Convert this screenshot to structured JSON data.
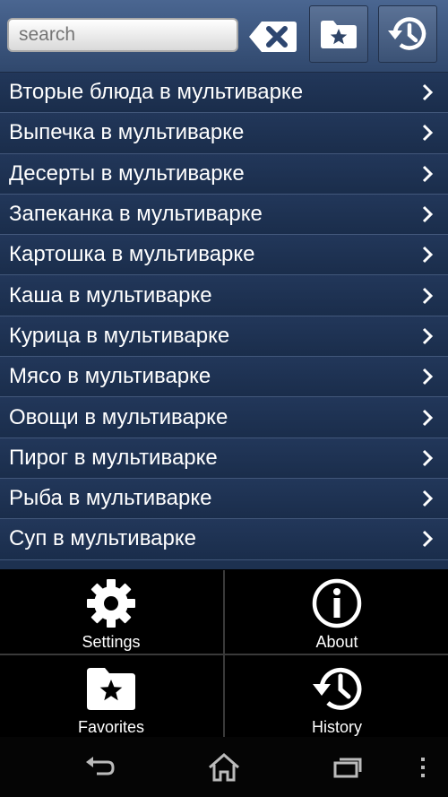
{
  "search": {
    "placeholder": "search"
  },
  "list": {
    "items": [
      {
        "label": "Вторые блюда в мультиварке"
      },
      {
        "label": "Выпечка в мультиварке"
      },
      {
        "label": "Десерты в мультиварке"
      },
      {
        "label": "Запеканка в мультиварке"
      },
      {
        "label": "Картошка в мультиварке"
      },
      {
        "label": "Каша в мультиварке"
      },
      {
        "label": "Курица в мультиварке"
      },
      {
        "label": "Мясо в мультиварке"
      },
      {
        "label": "Овощи в мультиварке"
      },
      {
        "label": "Пирог в мультиварке"
      },
      {
        "label": "Рыба в мультиварке"
      },
      {
        "label": "Суп в мультиварке"
      }
    ]
  },
  "menu": {
    "settings": "Settings",
    "about": "About",
    "favorites": "Favorites",
    "history": "History"
  },
  "icons": {
    "clear": "clear-text-icon",
    "favorites": "star-folder-icon",
    "history": "history-clock-icon",
    "settings": "gear-icon",
    "about": "info-icon",
    "back": "back-icon",
    "home": "home-icon",
    "recents": "recent-apps-icon",
    "overflow": "overflow-menu-icon"
  },
  "colors": {
    "toolbar": "#3b5275",
    "list_bg": "#1d3150",
    "divider": "#42577a"
  }
}
